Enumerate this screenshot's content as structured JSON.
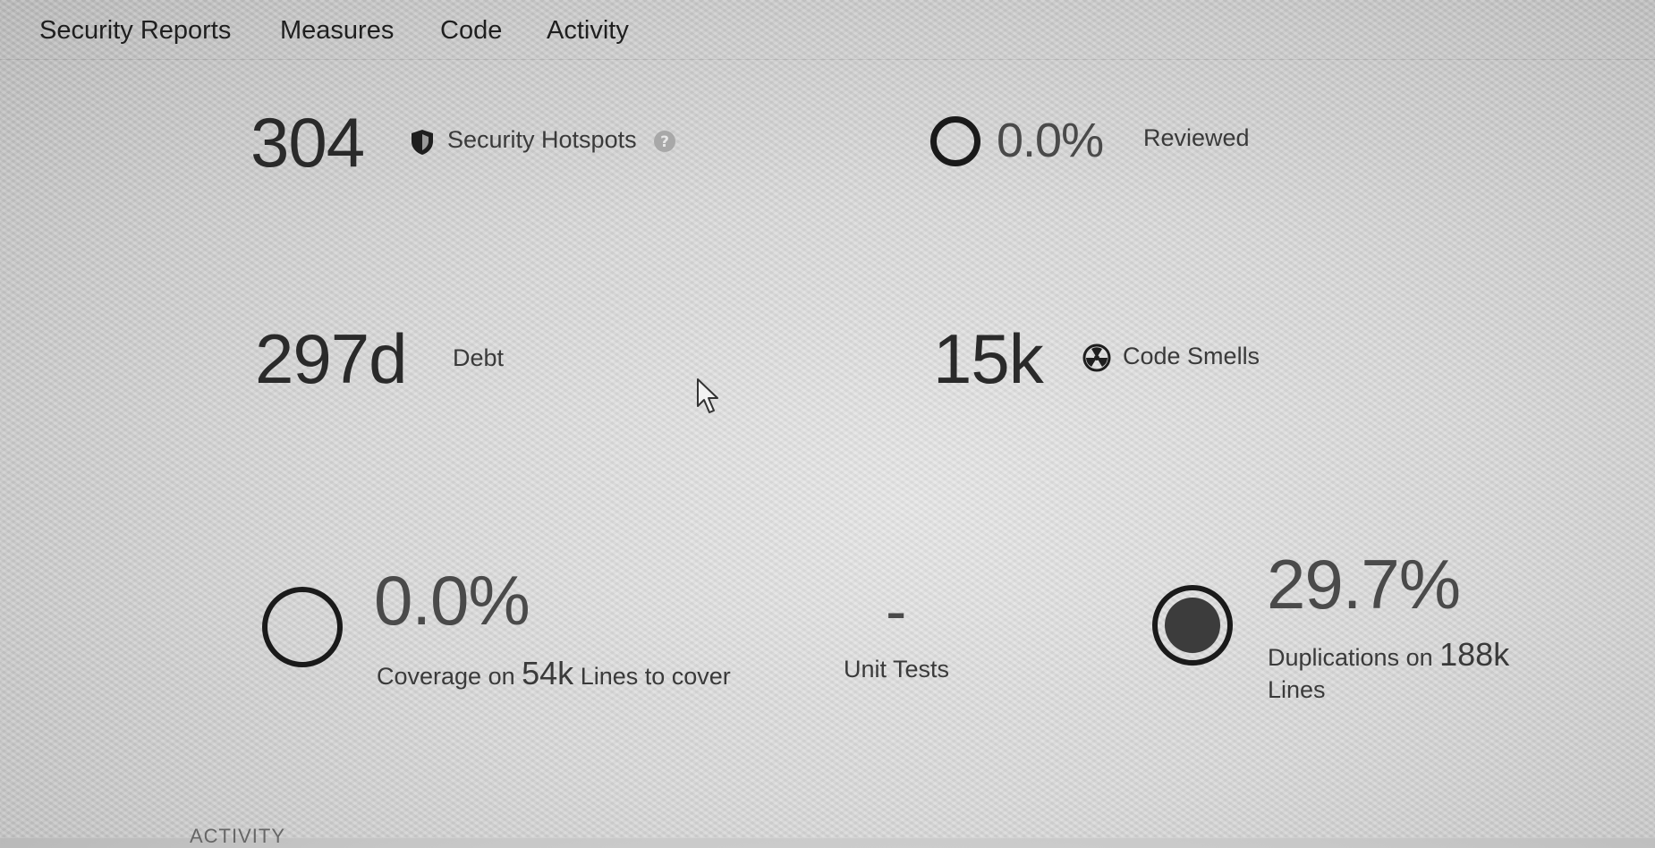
{
  "nav": {
    "tabs": [
      {
        "label": "Security Reports"
      },
      {
        "label": "Measures"
      },
      {
        "label": "Code"
      },
      {
        "label": "Activity"
      }
    ]
  },
  "security": {
    "hotspots_count": "304",
    "hotspots_label": "Security Hotspots",
    "reviewed_percent": "0.0%",
    "reviewed_label": "Reviewed"
  },
  "maintainability": {
    "debt_value": "297d",
    "debt_label": "Debt",
    "code_smells_value": "15k",
    "code_smells_label": "Code Smells"
  },
  "coverage": {
    "percent": "0.0%",
    "label_prefix": "Coverage on",
    "lines_value": "54k",
    "label_suffix": "Lines to cover",
    "unit_tests_value": "-",
    "unit_tests_label": "Unit Tests"
  },
  "duplications": {
    "percent": "29.7%",
    "label_prefix": "Duplications on",
    "lines_value": "188k",
    "label_suffix": "Lines"
  },
  "footer": {
    "activity_heading": "ACTIVITY"
  },
  "icons": [
    "shield-icon",
    "help-icon",
    "radiation-icon",
    "coverage-ring-icon",
    "duplication-ring-icon",
    "reviewed-ring-icon",
    "cursor-icon"
  ]
}
